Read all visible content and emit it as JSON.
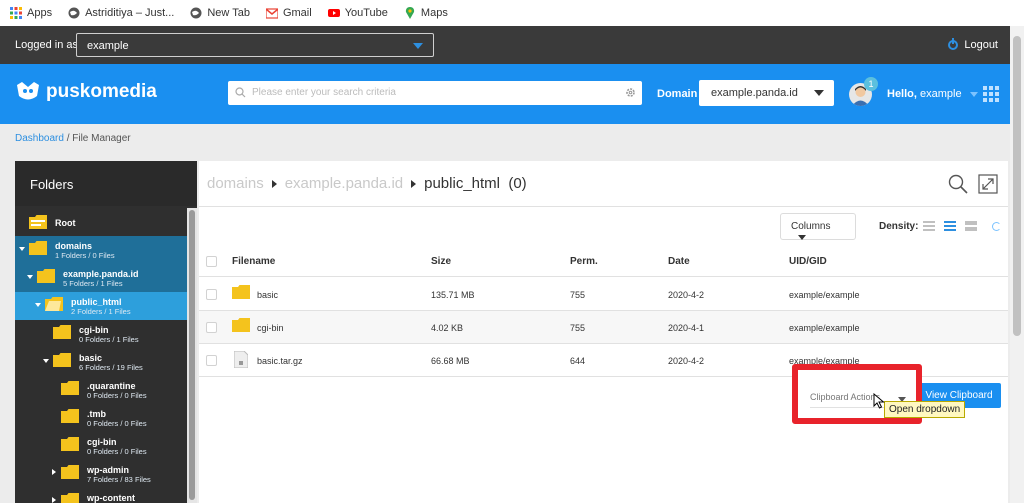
{
  "bookmarks": [
    {
      "label": "Apps",
      "icon": "apps-grid-icon"
    },
    {
      "label": "Astriditiya – Just...",
      "icon": "globe-icon"
    },
    {
      "label": "New Tab",
      "icon": "globe-icon"
    },
    {
      "label": "Gmail",
      "icon": "gmail-icon"
    },
    {
      "label": "YouTube",
      "icon": "youtube-icon"
    },
    {
      "label": "Maps",
      "icon": "maps-pin-icon"
    }
  ],
  "login": {
    "label": "Logged in as",
    "user": "example",
    "logout": "Logout"
  },
  "header": {
    "brand": "puskomedia",
    "search_placeholder": "Please enter your search criteria",
    "domain_label": "Domain",
    "domain_value": "example.panda.id",
    "notifications": "1",
    "hello_prefix": "Hello,",
    "hello_user": "example"
  },
  "breadcrumb": {
    "root": "Dashboard",
    "current": "/ File Manager"
  },
  "folders": {
    "title": "Folders",
    "tree": [
      {
        "name": "Root",
        "count": ""
      },
      {
        "name": "domains",
        "count": "1 Folders / 0 Files"
      },
      {
        "name": "example.panda.id",
        "count": "5 Folders / 1 Files"
      },
      {
        "name": "public_html",
        "count": "2 Folders / 1 Files"
      },
      {
        "name": "cgi-bin",
        "count": "0 Folders / 1 Files"
      },
      {
        "name": "basic",
        "count": "6 Folders / 19 Files"
      },
      {
        "name": ".quarantine",
        "count": "0 Folders / 0 Files"
      },
      {
        "name": ".tmb",
        "count": "0 Folders / 0 Files"
      },
      {
        "name": "cgi-bin",
        "count": "0 Folders / 0 Files"
      },
      {
        "name": "wp-admin",
        "count": "7 Folders / 83 Files"
      },
      {
        "name": "wp-content",
        "count": ""
      }
    ]
  },
  "path": {
    "p1": "domains",
    "p2": "example.panda.id",
    "current": "public_html",
    "count": "(0)"
  },
  "toolbar": {
    "columns": "Columns",
    "density": "Density:"
  },
  "table": {
    "headers": {
      "filename": "Filename",
      "size": "Size",
      "perm": "Perm.",
      "date": "Date",
      "uid": "UID/GID"
    },
    "rows": [
      {
        "name": "basic",
        "size": "135.71 MB",
        "perm": "755",
        "date": "2020-4-2",
        "uid": "example/example",
        "type": "folder"
      },
      {
        "name": "cgi-bin",
        "size": "4.02 KB",
        "perm": "755",
        "date": "2020-4-1",
        "uid": "example/example",
        "type": "folder"
      },
      {
        "name": "basic.tar.gz",
        "size": "66.68 MB",
        "perm": "644",
        "date": "2020-4-2",
        "uid": "example/example",
        "type": "archive"
      }
    ]
  },
  "clipboard": {
    "actions": "Clipboard Actions",
    "view": "View Clipboard",
    "tooltip": "Open dropdown"
  },
  "colors": {
    "brand_blue": "#1a8ff0",
    "folder_yellow": "#f4c31d",
    "tree_active": "#2d9fdc",
    "tree_selected": "#1f6f99",
    "highlight_red": "#e8232b"
  }
}
